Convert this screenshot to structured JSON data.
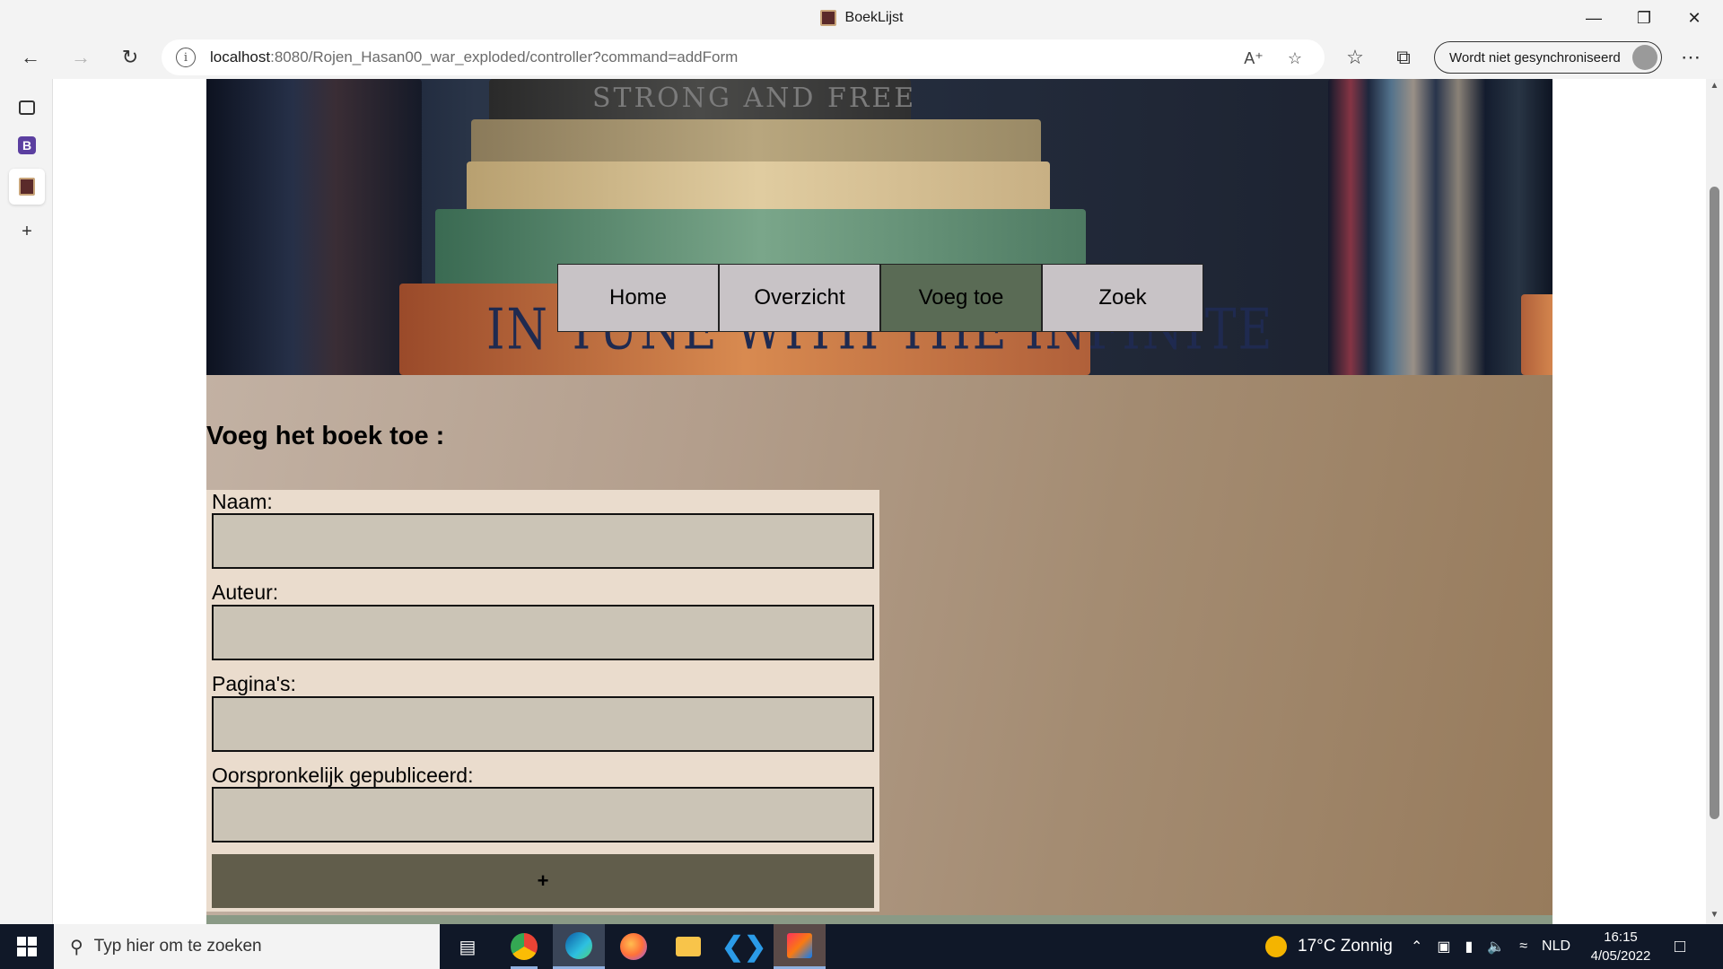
{
  "window": {
    "title": "BoekLijst",
    "minimize_icon": "minimize-icon",
    "restore_icon": "restore-icon",
    "close_icon": "close-icon"
  },
  "toolbar": {
    "url_host": "localhost",
    "url_path": ":8080/Rojen_Hasan00_war_exploded/controller?command=addForm",
    "profile_label": "Wordt niet gesynchroniseerd"
  },
  "site": {
    "nav": [
      {
        "label": "Home",
        "active": false
      },
      {
        "label": "Overzicht",
        "active": false
      },
      {
        "label": "Voeg toe",
        "active": true
      },
      {
        "label": "Zoek",
        "active": false
      }
    ],
    "heading": "Voeg het boek toe :",
    "form": {
      "fields": [
        {
          "label": "Naam:",
          "value": ""
        },
        {
          "label": "Auteur:",
          "value": ""
        },
        {
          "label": "Pagina's:",
          "value": ""
        },
        {
          "label": "Oorspronkelijk gepubliceerd:",
          "value": ""
        }
      ],
      "submit_label": "+"
    },
    "hero_texts": {
      "top": "STRONG AND FREE",
      "spine": "IN TUNE WITH THE INFINITE"
    },
    "colors": {
      "nav_active": "#5a6b55",
      "nav_default": "#c8c3c6",
      "form_bg": "#eadccd",
      "input_bg": "#cbc4b6",
      "submit_bg": "#615d4b"
    }
  },
  "taskbar": {
    "search_placeholder": "Typ hier om te zoeken",
    "weather": "17°C Zonnig",
    "language": "NLD",
    "time": "16:15",
    "date": "4/05/2022"
  }
}
